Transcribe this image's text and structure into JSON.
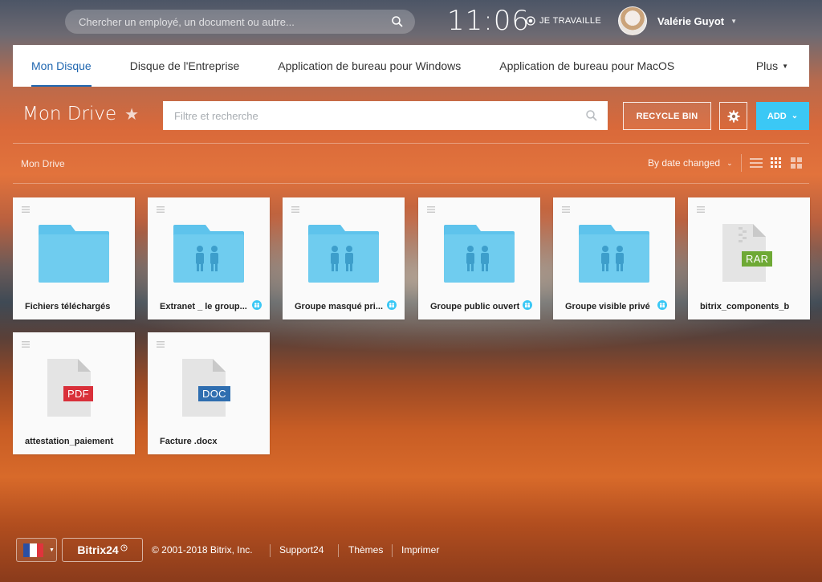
{
  "header": {
    "search_placeholder": "Chercher un employé, un document ou autre...",
    "clock": "11:06",
    "work_status": "JE TRAVAILLE",
    "user_name": "Valérie Guyot"
  },
  "tabs": [
    {
      "label": "Mon Disque",
      "active": true
    },
    {
      "label": "Disque de l'Entreprise"
    },
    {
      "label": "Application de bureau pour Windows"
    },
    {
      "label": "Application de bureau pour MacOS"
    }
  ],
  "tabs_more": "Plus",
  "page": {
    "title": "Mon Drive",
    "filter_placeholder": "Filtre et recherche",
    "recycle_label": "RECYCLE BIN",
    "add_label": "ADD",
    "breadcrumb": "Mon Drive",
    "sort_label": "By date changed"
  },
  "files": [
    {
      "name": "Fichiers téléchargés",
      "type": "folder",
      "shared": false
    },
    {
      "name": "Extranet _ le group...",
      "type": "group-folder",
      "shared": true
    },
    {
      "name": "Groupe masqué pri...",
      "type": "group-folder",
      "shared": true
    },
    {
      "name": "Groupe public ouvert",
      "type": "group-folder",
      "shared": true
    },
    {
      "name": "Groupe visible privé",
      "type": "group-folder",
      "shared": true
    },
    {
      "name": "bitrix_components_bit...",
      "type": "file",
      "badge": "RAR",
      "badge_color": "#6ea935",
      "shared": false
    },
    {
      "name": "attestation_paiement....",
      "type": "file",
      "badge": "PDF",
      "badge_color": "#d9303a",
      "shared": false
    },
    {
      "name": "Facture .docx",
      "type": "file",
      "badge": "DOC",
      "badge_color": "#2f6eb0",
      "shared": false
    }
  ],
  "footer": {
    "brand": "Bitrix24",
    "copyright": "© 2001-2018 Bitrix, Inc.",
    "links": [
      "Support24",
      "Thèmes",
      "Imprimer"
    ]
  },
  "colors": {
    "accent": "#2067b0",
    "add_button": "#3bc8f5",
    "folder": "#5ec3ec"
  }
}
